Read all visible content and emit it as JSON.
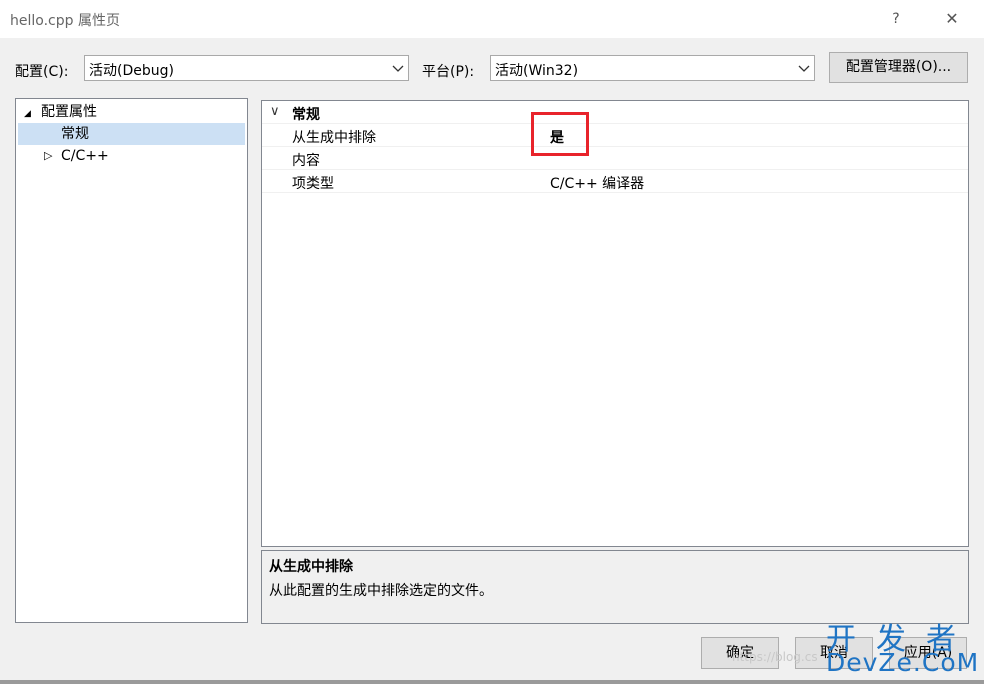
{
  "window": {
    "title": "hello.cpp 属性页",
    "help_label": "?",
    "close_label": "✕"
  },
  "toolbar": {
    "config_label": "配置(C):",
    "config_value": "活动(Debug)",
    "platform_label": "平台(P):",
    "platform_value": "活动(Win32)",
    "config_manager_label": "配置管理器(O)..."
  },
  "tree": {
    "root": {
      "label": "配置属性",
      "expander": "◢"
    },
    "items": [
      {
        "label": "常规",
        "selected": true
      },
      {
        "label": "C/C++",
        "expander": "▷"
      }
    ]
  },
  "grid": {
    "category": {
      "label": "常规",
      "expander": "∨"
    },
    "rows": [
      {
        "name": "从生成中排除",
        "value": "是"
      },
      {
        "name": "内容",
        "value": ""
      },
      {
        "name": "项类型",
        "value": "C/C++ 编译器"
      }
    ]
  },
  "description": {
    "title": "从生成中排除",
    "text": "从此配置的生成中排除选定的文件。"
  },
  "buttons": {
    "ok": "确定",
    "cancel": "取消",
    "apply": "应用(A)"
  },
  "watermark": {
    "url": "https://blog.cs",
    "line1": "开发者",
    "line2": "DevZe.CoM"
  },
  "colors": {
    "selection": "#cce0f4",
    "highlight_box": "#e8232b",
    "watermark": "#1f74c4"
  }
}
